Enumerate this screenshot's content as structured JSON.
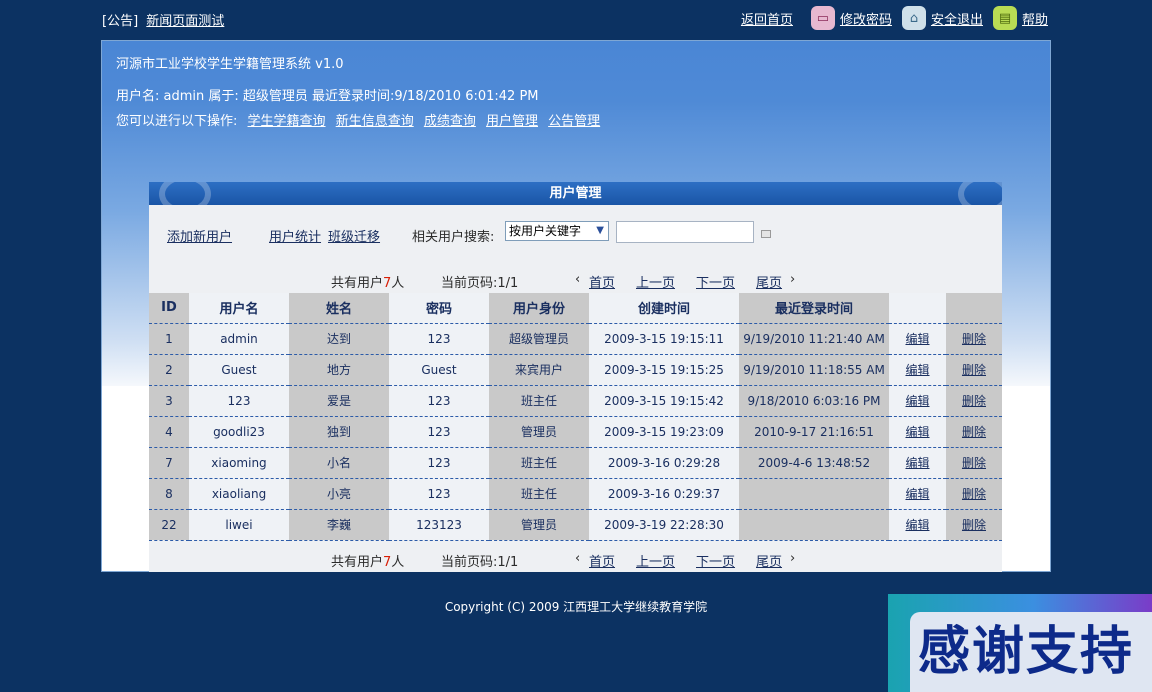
{
  "topbar": {
    "notice_tag": "[公告]",
    "notice_link": "新闻页面测试",
    "home_link": "返回首页",
    "change_password": "修改密码",
    "logout": "安全退出",
    "help": "帮助"
  },
  "header": {
    "system_name": "河源市工业学校学生学籍管理系统 v1.0",
    "user_info": "用户名: admin 属于: 超级管理员 最近登录时间:9/18/2010 6:01:42 PM",
    "ops_label": "您可以进行以下操作:",
    "ops": [
      "学生学籍查询",
      "新生信息查询",
      "成绩查询",
      "用户管理",
      "公告管理"
    ]
  },
  "panel": {
    "title": "用户管理",
    "add_user": "添加新用户",
    "user_stats": "用户统计",
    "class_move": "班级迁移",
    "search_label": "相关用户搜索:",
    "search_select": "按用户关键字",
    "search_value": ""
  },
  "pager": {
    "total_prefix": "共有用户",
    "total_count": "7",
    "total_suffix": "人",
    "current_page": "当前页码:1/1",
    "first": "首页",
    "prev": "上一页",
    "next": "下一页",
    "last": "尾页"
  },
  "table": {
    "headers": [
      "ID",
      "用户名",
      "姓名",
      "密码",
      "用户身份",
      "创建时间",
      "最近登录时间",
      "",
      ""
    ],
    "edit_label": "编辑",
    "delete_label": "删除",
    "rows": [
      [
        "1",
        "admin",
        "达到",
        "123",
        "超级管理员",
        "2009-3-15 19:15:11",
        "9/19/2010 11:21:40 AM"
      ],
      [
        "2",
        "Guest",
        "地方",
        "Guest",
        "来宾用户",
        "2009-3-15 19:15:25",
        "9/19/2010 11:18:55 AM"
      ],
      [
        "3",
        "123",
        "爱是",
        "123",
        "班主任",
        "2009-3-15 19:15:42",
        "9/18/2010 6:03:16 PM"
      ],
      [
        "4",
        "goodli23",
        "独到",
        "123",
        "管理员",
        "2009-3-15 19:23:09",
        "2010-9-17 21:16:51"
      ],
      [
        "7",
        "xiaoming",
        "小名",
        "123",
        "班主任",
        "2009-3-16 0:29:28",
        "2009-4-6 13:48:52"
      ],
      [
        "8",
        "xiaoliang",
        "小亮",
        "123",
        "班主任",
        "2009-3-16 0:29:37",
        ""
      ],
      [
        "22",
        "liwei",
        "李巍",
        "123123",
        "管理员",
        "2009-3-19 22:28:30",
        ""
      ]
    ]
  },
  "footer": {
    "copyright": "Copyright (C) 2009 江西理工大学继续教育学院"
  },
  "badge": {
    "text": "感谢支持"
  }
}
